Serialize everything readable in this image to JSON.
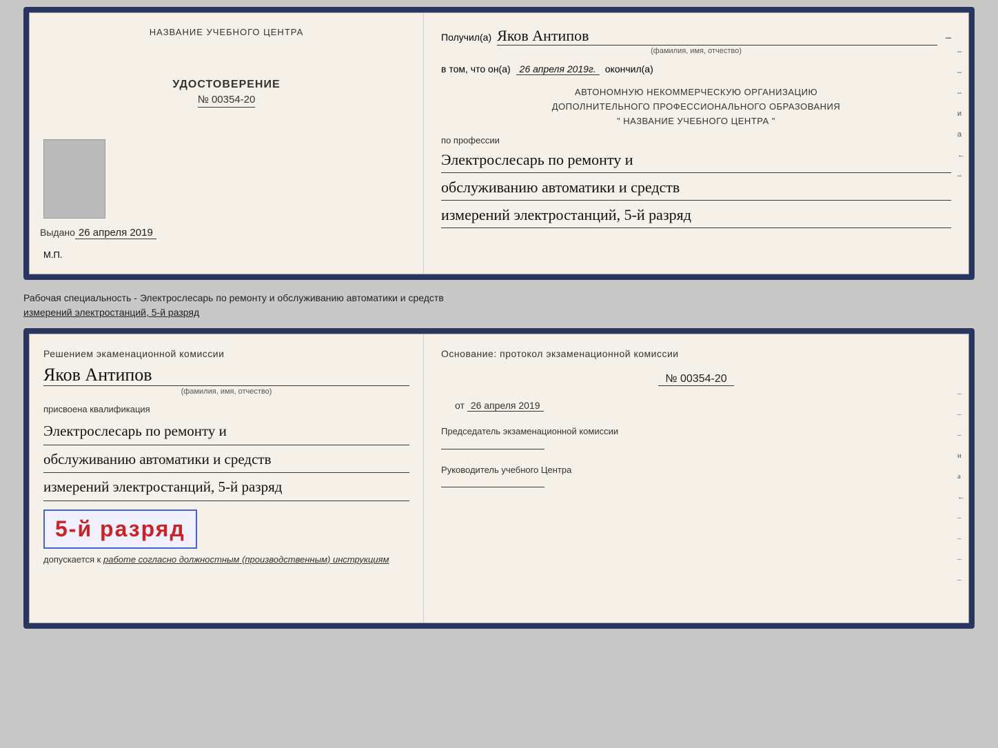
{
  "doc1": {
    "left": {
      "center_title": "НАЗВАНИЕ УЧЕБНОГО ЦЕНТРА",
      "certificate_label": "УДОСТОВЕРЕНИЕ",
      "certificate_number": "№ 00354-20",
      "issued_label": "Выдано",
      "issued_date": "26 апреля 2019",
      "mp_label": "М.П."
    },
    "right": {
      "recipient_prefix": "Получил(а)",
      "recipient_name": "Яков Антипов",
      "fio_label": "(фамилия, имя, отчество)",
      "in_that_prefix": "в том, что он(а)",
      "completion_date": "26 апреля 2019г.",
      "finished_label": "окончил(а)",
      "org_line1": "АВТОНОМНУЮ НЕКОММЕРЧЕСКУЮ ОРГАНИЗАЦИЮ",
      "org_line2": "ДОПОЛНИТЕЛЬНОГО ПРОФЕССИОНАЛЬНОГО ОБРАЗОВАНИЯ",
      "org_line3": "\"  НАЗВАНИЕ УЧЕБНОГО ЦЕНТРА  \"",
      "profession_label": "по профессии",
      "profession_line1": "Электрослесарь по ремонту и",
      "profession_line2": "обслуживанию автоматики и средств",
      "profession_line3": "измерений электростанций, 5-й разряд",
      "side_marks": [
        "-",
        "-",
        "-",
        "и",
        "а",
        "←",
        "-"
      ]
    }
  },
  "between_text": {
    "line1": "Рабочая специальность - Электрослесарь по ремонту и обслуживанию автоматики и средств",
    "line2_underline": "измерений электростанций, 5-й разряд"
  },
  "doc2": {
    "left": {
      "exam_title": "Решением экаменационной комиссии",
      "person_name": "Яков Антипов",
      "fio_label": "(фамилия, имя, отчество)",
      "qualification_label": "присвоена квалификация",
      "qual_line1": "Электрослесарь по ремонту и",
      "qual_line2": "обслуживанию автоматики и средств",
      "qual_line3": "измерений электростанций, 5-й разряд",
      "rank_text": "5-й разряд",
      "admitted_text": "допускается к",
      "admitted_italic": "работе согласно должностным (производственным) инструкциям"
    },
    "right": {
      "basis_label": "Основание: протокол экзаменационной комиссии",
      "protocol_number": "№  00354-20",
      "date_from_prefix": "от",
      "date_from_value": "26 апреля 2019",
      "chairman_label": "Председатель экзаменационной комиссии",
      "director_label": "Руководитель учебного Центра",
      "side_marks": [
        "-",
        "-",
        "-",
        "и",
        "а",
        "←",
        "-",
        "-",
        "-",
        "-"
      ]
    }
  }
}
